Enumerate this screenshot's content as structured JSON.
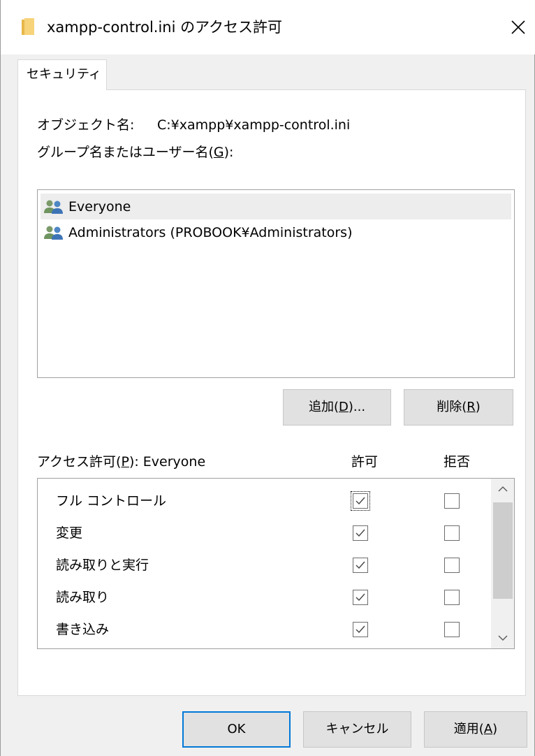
{
  "window": {
    "title": "xampp-control.ini のアクセス許可",
    "close_icon": "close-icon",
    "folder_icon": "folder-icon"
  },
  "tabs": [
    {
      "label": "セキュリティ",
      "active": true
    }
  ],
  "object": {
    "label": "オブジェクト名:",
    "value": "C:¥xampp¥xampp-control.ini"
  },
  "group_label": {
    "prefix": "グループ名またはユーザー名(",
    "accel": "G",
    "suffix": "):"
  },
  "users": [
    {
      "name": "Everyone",
      "icon": "users-icon",
      "selected": true
    },
    {
      "name": "Administrators (PROBOOK¥Administrators)",
      "icon": "users-icon",
      "selected": false
    }
  ],
  "buttons": {
    "add": {
      "prefix": "追加(",
      "accel": "D",
      "suffix": ")..."
    },
    "remove": {
      "prefix": "削除(",
      "accel": "R",
      "suffix": ")"
    },
    "ok": "OK",
    "cancel": "キャンセル",
    "apply": {
      "prefix": "適用(",
      "accel": "A",
      "suffix": ")"
    }
  },
  "permissions": {
    "header_prefix": "アクセス許可(",
    "header_accel": "P",
    "header_suffix": "): Everyone",
    "allow_label": "許可",
    "deny_label": "拒否",
    "rows": [
      {
        "name": "フル コントロール",
        "allow": true,
        "deny": false
      },
      {
        "name": "変更",
        "allow": true,
        "deny": false
      },
      {
        "name": "読み取りと実行",
        "allow": true,
        "deny": false
      },
      {
        "name": "読み取り",
        "allow": true,
        "deny": false
      },
      {
        "name": "書き込み",
        "allow": true,
        "deny": false
      }
    ]
  },
  "colors": {
    "accent": "#0078d7",
    "selection": "#ededed",
    "button_face": "#e1e1e1"
  }
}
